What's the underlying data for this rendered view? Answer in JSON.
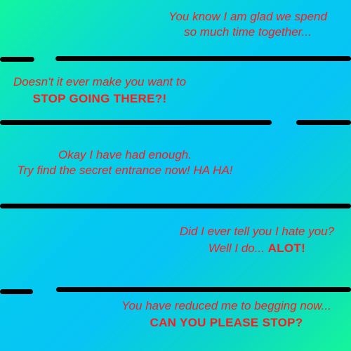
{
  "messages": {
    "m1": {
      "line1": "You know I am glad we spend",
      "line2": "so much time together..."
    },
    "m2": {
      "line1": "Doesn't it ever make you want to",
      "line2": "STOP GOING THERE?!"
    },
    "m3": {
      "line1": "Okay I have had enough.",
      "line2": "Try find the secret entrance now! HA HA!"
    },
    "m4": {
      "line1": "Did I ever tell you I hate you?",
      "line2_prefix": "Well I do... ",
      "line2_bold": "ALOT!"
    },
    "m5": {
      "line1": "You have reduced me to begging now...",
      "line2": "CAN YOU PLEASE STOP?"
    }
  },
  "colors": {
    "text": "#ff1a1a",
    "wall": "#000000",
    "bg_green": "#12f5a0",
    "bg_blue": "#05c8f2"
  }
}
